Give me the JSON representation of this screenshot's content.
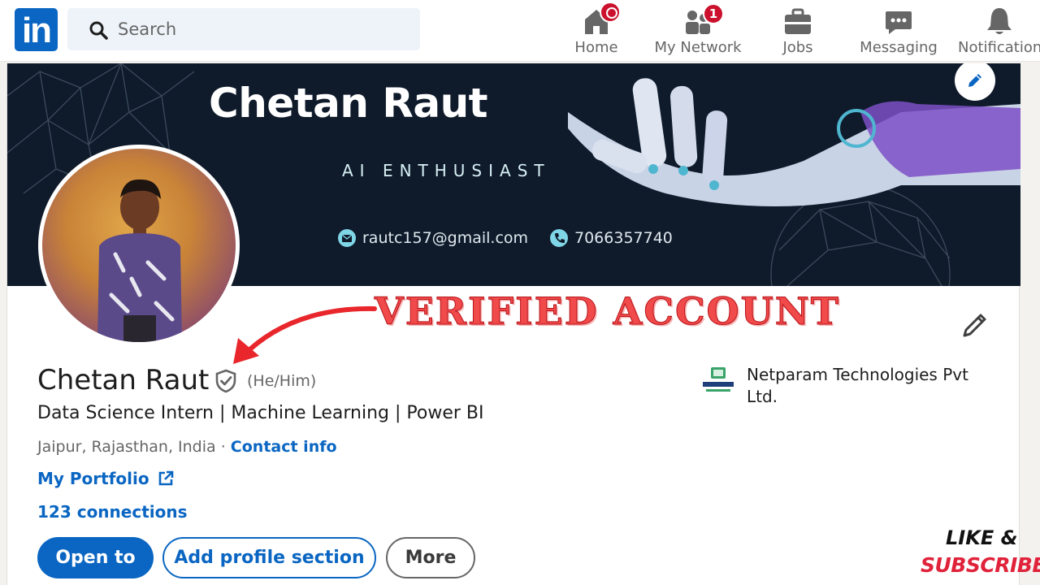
{
  "nav": {
    "logo": "in",
    "search_placeholder": "Search",
    "items": [
      {
        "label": "Home",
        "badge": ""
      },
      {
        "label": "My Network",
        "badge": "1"
      },
      {
        "label": "Jobs",
        "badge": ""
      },
      {
        "label": "Messaging",
        "badge": ""
      },
      {
        "label": "Notifications",
        "badge": ""
      }
    ]
  },
  "banner": {
    "name": "Chetan Raut",
    "tagline": "AI ENTHUSIAST",
    "email": "rautc157@gmail.com",
    "phone": "7066357740"
  },
  "overlay": {
    "verified_text": "VERIFIED ACCOUNT",
    "like_text": "LIKE &",
    "subscribe_text": "SUBSCRIBE"
  },
  "profile": {
    "name": "Chetan Raut",
    "pronouns": "(He/Him)",
    "headline": "Data Science Intern | Machine Learning | Power BI",
    "location": "Jaipur, Rajasthan, India",
    "separator": "·",
    "contact_info": "Contact info",
    "portfolio": "My Portfolio",
    "connections": "123 connections",
    "company": "Netparam Technologies Pvt Ltd."
  },
  "actions": {
    "open_to": "Open to",
    "add_section": "Add profile section",
    "more": "More"
  },
  "colors": {
    "brand": "#0a66c2",
    "badge": "#cb112d",
    "banner_bg": "#0f1b2b",
    "overlay_red": "#f04a4a"
  }
}
